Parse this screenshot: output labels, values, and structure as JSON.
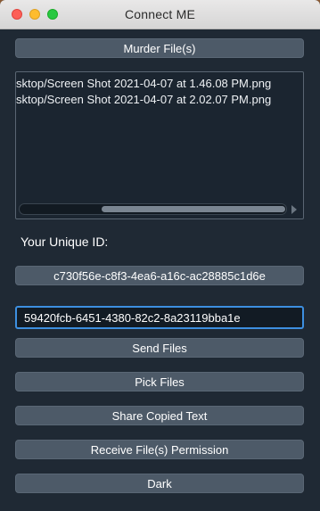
{
  "window": {
    "title": "Connect ME"
  },
  "buttons": {
    "murder": "Murder File(s)",
    "unique_id": "c730f56e-c8f3-4ea6-a16c-ac28885c1d6e",
    "send": "Send Files",
    "pick": "Pick Files",
    "share_text": "Share Copied Text",
    "receive_permission": "Receive File(s) Permission",
    "dark": "Dark"
  },
  "file_list": {
    "items": [
      "sktop/Screen Shot 2021-04-07 at 1.46.08 PM.png",
      "sktop/Screen Shot 2021-04-07 at 2.02.07 PM.png"
    ]
  },
  "unique_id_label": "Your Unique ID:",
  "peer_id_input": {
    "value": "59420fcb-6451-4380-82c2-8a23119bba1e"
  },
  "colors": {
    "window_bg": "#1f2934",
    "button_bg": "#4d5a68",
    "focus_ring": "#3d8fe0"
  }
}
